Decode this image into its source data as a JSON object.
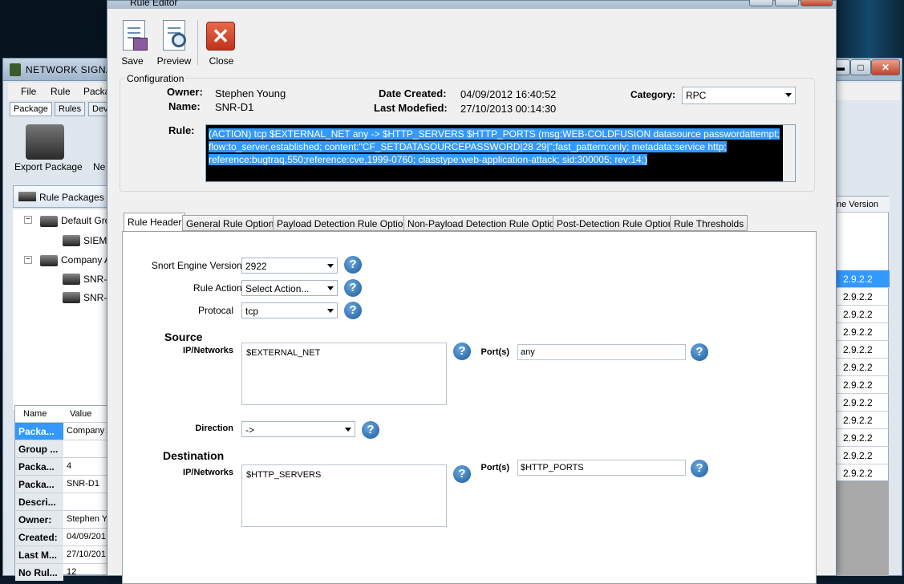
{
  "back": {
    "title": "NETWORK SIGNAT",
    "menu": [
      "File",
      "Rule",
      "Packa"
    ],
    "tabs": [
      "Package",
      "Rules",
      "Dev"
    ],
    "export_label": "Export Package",
    "new_label": "Ne",
    "rule_packages": "Rule Packages",
    "tree": [
      {
        "label": "Default Grou",
        "expander": "−"
      },
      {
        "label": "SIEM",
        "expander": ""
      },
      {
        "label": "Company A",
        "expander": "−"
      },
      {
        "label": "SNR-I",
        "expander": ""
      },
      {
        "label": "SNR-I",
        "expander": ""
      }
    ],
    "grid_headers": [
      "Name",
      "Value"
    ],
    "grid_rows": [
      {
        "k": "Packa...",
        "v": "Company A"
      },
      {
        "k": "Group ...",
        "v": ""
      },
      {
        "k": "Packa...",
        "v": "4"
      },
      {
        "k": "Packa...",
        "v": "SNR-D1"
      },
      {
        "k": "Descri...",
        "v": ""
      },
      {
        "k": "Owner:",
        "v": "Stephen Y"
      },
      {
        "k": "Created:",
        "v": "04/09/201"
      },
      {
        "k": "Last M...",
        "v": "27/10/201"
      },
      {
        "k": "No Rul...",
        "v": "12"
      }
    ],
    "right_header": "ne Version",
    "right_values": [
      "2.9.2.2",
      "2.9.2.2",
      "2.9.2.2",
      "2.9.2.2",
      "2.9.2.2",
      "2.9.2.2",
      "2.9.2.2",
      "2.9.2.2",
      "2.9.2.2",
      "2.9.2.2",
      "2.9.2.2",
      "2.9.2.2"
    ],
    "min": "▬",
    "max": "□",
    "close": "✕"
  },
  "editor": {
    "title": "Rule Editor",
    "toolbar": {
      "save": "Save",
      "preview": "Preview",
      "close": "Close",
      "close_glyph": "✕"
    },
    "config_label": "Configuration",
    "owner_label": "Owner:",
    "owner": "Stephen Young",
    "name_label": "Name:",
    "name": "SNR-D1",
    "date_created_label": "Date Created:",
    "date_created": "04/09/2012 16:40:52",
    "last_modified_label": "Last Modefied:",
    "last_modified": "27/10/2013 00:14:30",
    "category_label": "Category:",
    "category": "RPC",
    "rule_label": "Rule:",
    "rule_text": "(ACTION) tcp $EXTERNAL_NET any -> $HTTP_SERVERS $HTTP_PORTS (msg:WEB-COLDFUSION datasource passwordattempt; flow:to_server,established; content:\"CF_SETDATASOURCEPASSWORD|28 29|\";fast_pattern:only; metadata:service http; reference:bugtraq,550;reference:cve,1999-0760; classtype:web-application-attack; sid:300005; rev:14;)",
    "tabs": [
      "Rule Header",
      "General Rule Options",
      "Payload Detection Rule Options",
      "Non-Payload Detection Rule Options",
      "Post-Detection Rule Options",
      "Rule Thresholds"
    ],
    "header": {
      "snort_label": "Snort Engine Version:",
      "snort_value": "2922",
      "action_label": "Rule Action:",
      "action_value": "Select Action...",
      "protocol_label": "Protocal",
      "protocol_value": "tcp",
      "source_title": "Source",
      "src_ip_label": "IP/Networks",
      "src_ip": "$EXTERNAL_NET",
      "src_port_label": "Port(s)",
      "src_port": "any",
      "direction_label": "Direction",
      "direction": "->",
      "dest_title": "Destination",
      "dst_ip_label": "IP/Networks",
      "dst_ip": "$HTTP_SERVERS",
      "dst_port_label": "Port(s)",
      "dst_port": "$HTTP_PORTS",
      "help": "?"
    }
  }
}
